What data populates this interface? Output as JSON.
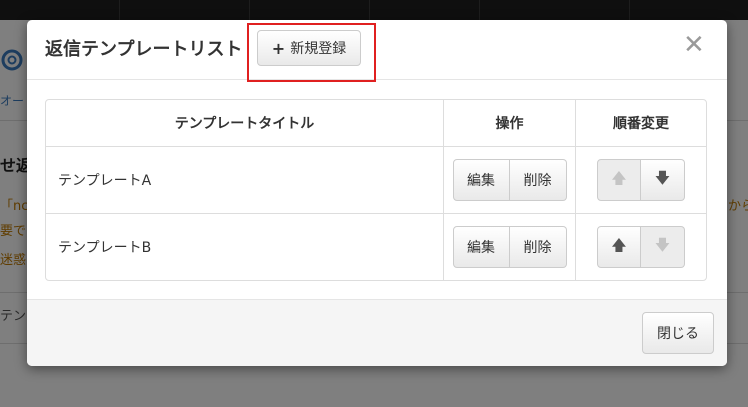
{
  "background": {
    "snippets": [
      "オー",
      "せ返",
      "「nc",
      "要で",
      "迷惑",
      "テン",
      "から"
    ]
  },
  "modal": {
    "title": "返信テンプレートリスト",
    "new_button": {
      "icon": "plus-icon",
      "label": "新規登録"
    },
    "close_icon": "close-icon",
    "table": {
      "headers": [
        "テンプレートタイトル",
        "操作",
        "順番変更"
      ],
      "rows": [
        {
          "title": "テンプレートA",
          "edit": "編集",
          "delete": "削除",
          "up_enabled": false,
          "down_enabled": true
        },
        {
          "title": "テンプレートB",
          "edit": "編集",
          "delete": "削除",
          "up_enabled": true,
          "down_enabled": false
        }
      ]
    },
    "footer": {
      "close_label": "閉じる"
    }
  },
  "colors": {
    "highlight": "#e02020"
  }
}
